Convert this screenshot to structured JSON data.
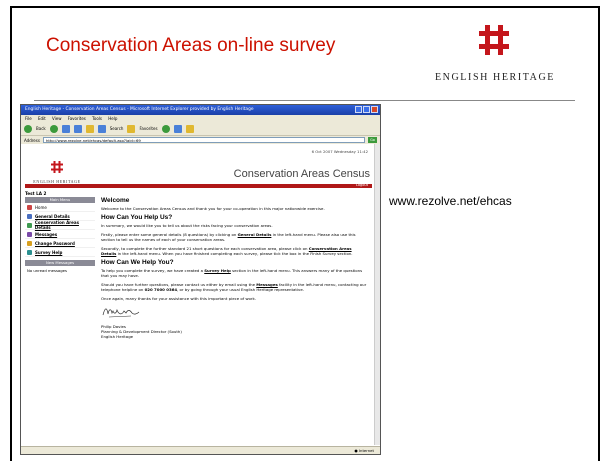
{
  "slide": {
    "title": "Conservation Areas on-line survey",
    "logo_text": "ENGLISH HERITAGE",
    "url_caption": "www.rezolve.net/ehcas"
  },
  "browser": {
    "window_title": "English Heritage - Conservation Areas Census - Microsoft Internet Explorer provided by English Heritage",
    "menu": [
      "File",
      "Edit",
      "View",
      "Favorites",
      "Tools",
      "Help"
    ],
    "toolbar": {
      "back": "Back",
      "search": "Search",
      "favorites": "Favorites"
    },
    "address_label": "Address",
    "address_value": "http://www.rezolve.net/ehcas/default.asp?laid=69",
    "go_label": "Go",
    "status_text": "Internet"
  },
  "site": {
    "date": "6 Oct 2007 Wednesday 11:42",
    "logo_text": "ENGLISH HERITAGE",
    "census_title": "Conservation Areas Census",
    "logout": "Logout",
    "la_name": "Test LA 2",
    "main_menu_heading": "Main Menu",
    "menu_items": [
      {
        "label": "Home",
        "icon": "home-icon"
      },
      {
        "label": "General Details",
        "icon": "details-icon"
      },
      {
        "label": "Conservation Areas Details",
        "icon": "search-icon"
      },
      {
        "label": "Messages",
        "icon": "messages-icon"
      },
      {
        "label": "Change Password",
        "icon": "key-icon"
      },
      {
        "label": "Survey Help",
        "icon": "help-icon"
      }
    ],
    "new_messages_heading": "New Messages",
    "no_messages": "No unread messages"
  },
  "content": {
    "welcome_heading": "Welcome",
    "welcome_text": "Welcome to the Conservation Areas Census and thank you for your co-operation in this major nationwide exercise.",
    "help_us_heading": "How Can You Help Us?",
    "help_us_p1": "In summary, we would like you to tell us about the risks facing your conservation areas.",
    "help_us_p2a": "Firstly, please enter some general details (8 questions) by clicking on",
    "help_us_p2_link": "General Details",
    "help_us_p2b": "in the left-hand menu. Please also use this section to tell us the names of each of your conservation areas.",
    "help_us_p3a": "Secondly, to complete the further standard 21 short questions for each conservation area, please click on",
    "help_us_p3_link": "Conservation Areas Details",
    "help_us_p3b": "in the left-hand menu. When you have finished completing each survey, please tick the box in the Finish Survey section.",
    "help_you_heading": "How Can We Help You?",
    "help_you_p1a": "To help you complete the survey, we have created a",
    "help_you_p1_link": "Survey Help",
    "help_you_p1b": "section in the left-hand menu. This answers many of the questions that you may have.",
    "help_you_p2a": "Should you have further questions, please contact us either by email using the",
    "help_you_p2_link": "Messages",
    "help_you_p2b": "facility in the left-hand menu, contacting our telephone helpline on",
    "help_you_phone": "020 7000 0364",
    "help_you_p2c": ", or by going through your usual English Heritage representative.",
    "thanks": "Once again, many thanks for your assistance with this important piece of work.",
    "signer_name": "Philip Davies",
    "signer_title": "Planning & Development Director (South)",
    "signer_org": "English Heritage"
  },
  "colors": {
    "title_red": "#cc1100",
    "logo_red": "#c4161c",
    "band_red": "#b01818",
    "xp_blue": "#2e5fd8"
  }
}
